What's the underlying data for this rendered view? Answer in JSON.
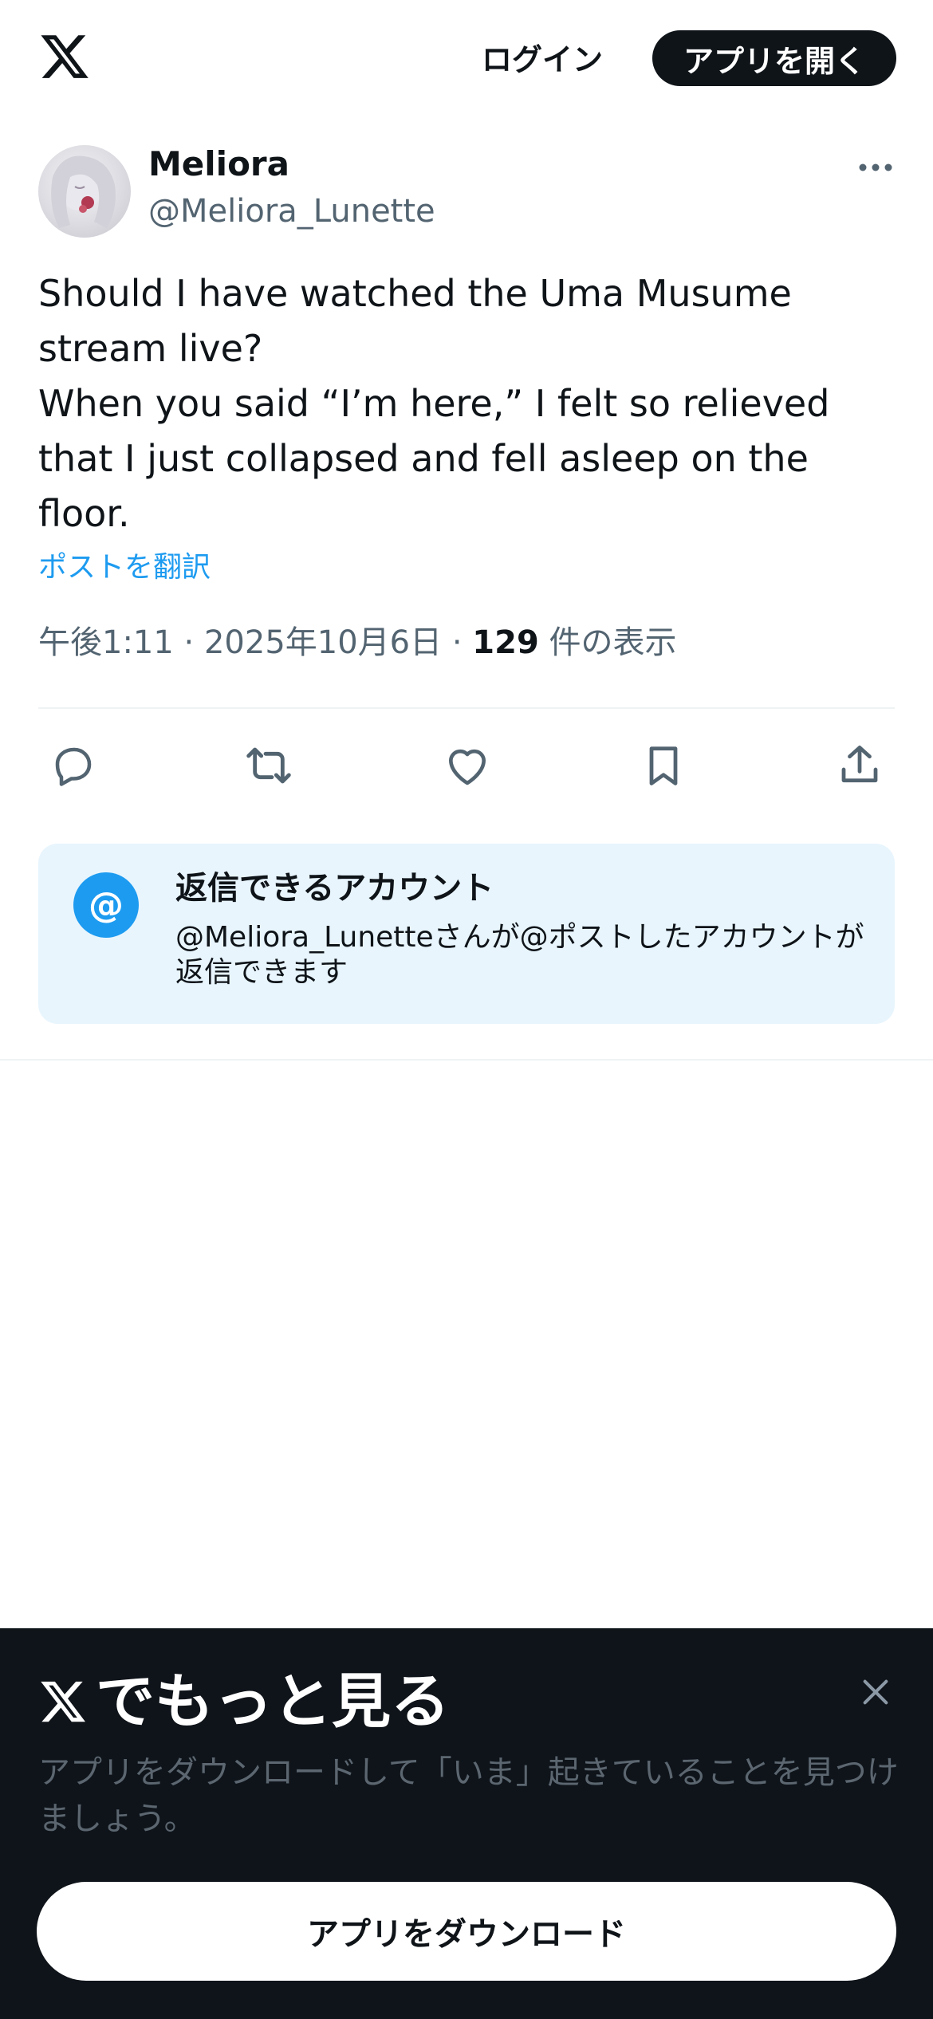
{
  "header": {
    "logo_icon": "x-logo-icon",
    "login_label": "ログイン",
    "open_app_label": "アプリを開く"
  },
  "author": {
    "display_name": "Meliora",
    "handle": "@Meliora_Lunette",
    "more_icon": "more-horizontal-icon"
  },
  "tweet": {
    "lines": [
      "Should I have watched the Uma Musume stream live?",
      "When you said “I’m here,” I felt so relieved that I just collapsed and fell asleep on the floor."
    ],
    "translate_label": "ポストを翻訳",
    "time": "午後1:11",
    "date": "2025年10月6日",
    "separator": " · ",
    "views_count": "129",
    "views_label": " 件の表示"
  },
  "actions": [
    {
      "icon": "reply-icon"
    },
    {
      "icon": "retweet-icon"
    },
    {
      "icon": "like-icon"
    },
    {
      "icon": "bookmark-icon"
    },
    {
      "icon": "share-icon"
    }
  ],
  "reply_restriction": {
    "icon_text": "@",
    "title": "返信できるアカウント",
    "description": "@Meliora_Lunetteさんが@ポストしたアカウントが返信できます"
  },
  "promo": {
    "title": "でもっと見る",
    "description": "アプリをダウンロードして「いま」起きていることを見つけましょう。",
    "download_label": "アプリをダウンロード"
  },
  "colors": {
    "accent": "#1d9bf0",
    "text": "#0f1419",
    "secondary": "#536471",
    "card_bg": "#e8f5fd",
    "promo_bg": "#0f141a"
  }
}
